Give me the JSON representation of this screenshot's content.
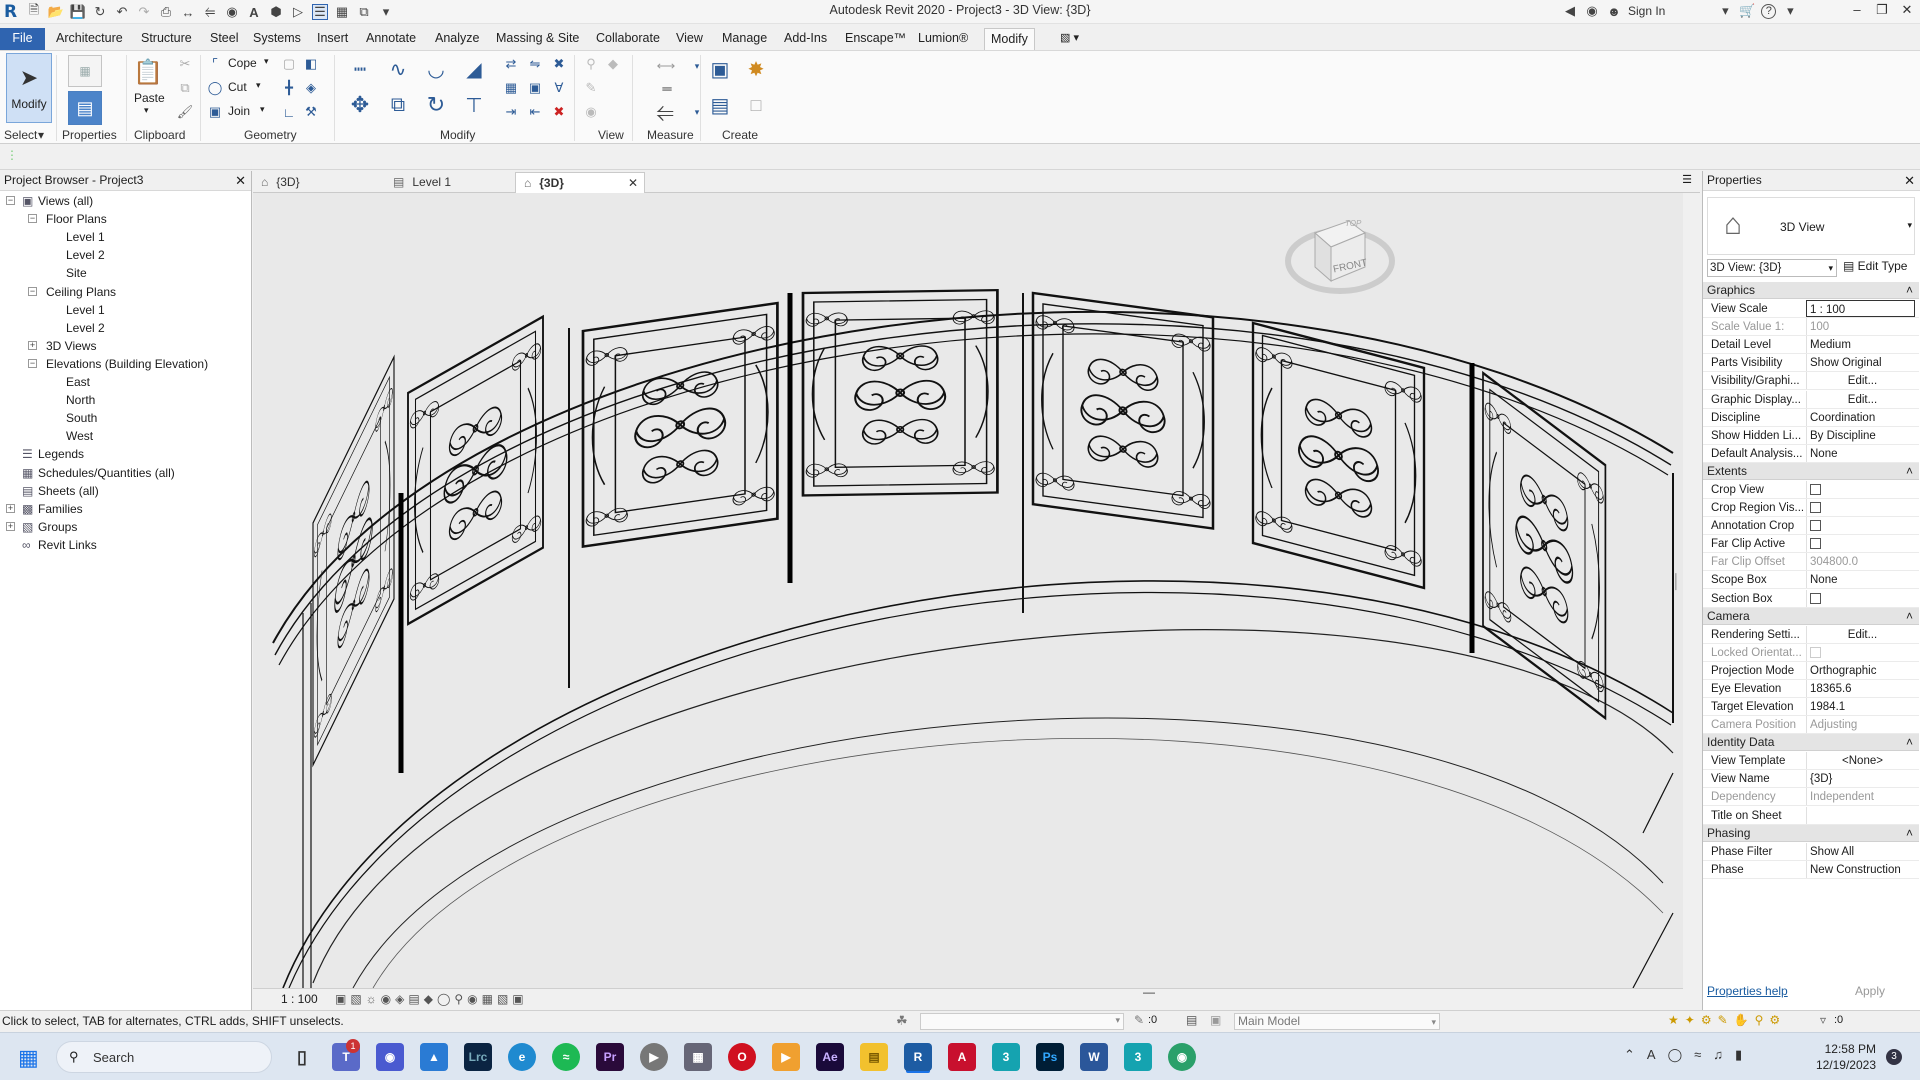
{
  "window": {
    "title": "Autodesk Revit 2020 - Project3 - 3D View: {3D}",
    "sign_in": "Sign In",
    "help": "?",
    "minimize": "–",
    "restore": "❐",
    "close": "✕"
  },
  "ribbon_tabs": [
    "File",
    "Architecture",
    "Structure",
    "Steel",
    "Systems",
    "Insert",
    "Annotate",
    "Analyze",
    "Massing & Site",
    "Collaborate",
    "View",
    "Manage",
    "Add-Ins",
    "Enscape™",
    "Lumion®",
    "Modify"
  ],
  "active_ribbon_tab": "Modify",
  "ribbon": {
    "modify_label": "Modify",
    "select_label": "Select",
    "properties_label": "Properties",
    "paste_label": "Paste",
    "clipboard_label": "Clipboard",
    "cope_label": "Cope",
    "cut_label": "Cut",
    "join_label": "Join",
    "geometry_label": "Geometry",
    "modify_panel_label": "Modify",
    "view_label": "View",
    "measure_label": "Measure",
    "create_label": "Create"
  },
  "project_browser": {
    "title": "Project Browser - Project3",
    "items": [
      {
        "label": "Views (all)",
        "level": 0,
        "toggle": "−",
        "icon": "views-icon"
      },
      {
        "label": "Floor Plans",
        "level": 1,
        "toggle": "−"
      },
      {
        "label": "Level 1",
        "level": 2
      },
      {
        "label": "Level 2",
        "level": 2
      },
      {
        "label": "Site",
        "level": 2
      },
      {
        "label": "Ceiling Plans",
        "level": 1,
        "toggle": "−"
      },
      {
        "label": "Level 1",
        "level": 2
      },
      {
        "label": "Level 2",
        "level": 2
      },
      {
        "label": "3D Views",
        "level": 1,
        "toggle": "+"
      },
      {
        "label": "Elevations (Building Elevation)",
        "level": 1,
        "toggle": "−"
      },
      {
        "label": "East",
        "level": 2
      },
      {
        "label": "North",
        "level": 2
      },
      {
        "label": "South",
        "level": 2
      },
      {
        "label": "West",
        "level": 2
      },
      {
        "label": "Legends",
        "level": 0,
        "icon": "legends-icon"
      },
      {
        "label": "Schedules/Quantities (all)",
        "level": 0,
        "icon": "schedules-icon"
      },
      {
        "label": "Sheets (all)",
        "level": 0,
        "icon": "sheets-icon"
      },
      {
        "label": "Families",
        "level": 0,
        "toggle": "+",
        "icon": "families-icon"
      },
      {
        "label": "Groups",
        "level": 0,
        "toggle": "+",
        "icon": "groups-icon"
      },
      {
        "label": "Revit Links",
        "level": 0,
        "icon": "links-icon"
      }
    ]
  },
  "view_tabs": [
    {
      "label": "{3D}",
      "active": false,
      "icon": "3d-view-icon"
    },
    {
      "label": "Level 1",
      "active": false,
      "icon": "floor-plan-icon"
    },
    {
      "label": "{3D}",
      "active": true,
      "icon": "3d-view-icon"
    }
  ],
  "view_control": {
    "scale": "1 : 100"
  },
  "viewcube": {
    "top": "TOP",
    "front": "FRONT"
  },
  "properties": {
    "title": "Properties",
    "type_name": "3D View",
    "selector": "3D View: {3D}",
    "edit_type": "Edit Type",
    "help_link": "Properties help",
    "apply": "Apply",
    "groups": [
      {
        "name": "Graphics",
        "rows": [
          {
            "label": "View Scale",
            "value": "1 : 100",
            "kind": "input"
          },
          {
            "label": "Scale Value    1:",
            "value": "100",
            "kind": "dim"
          },
          {
            "label": "Detail Level",
            "value": "Medium"
          },
          {
            "label": "Parts Visibility",
            "value": "Show Original"
          },
          {
            "label": "Visibility/Graphi...",
            "value": "Edit...",
            "kind": "btn"
          },
          {
            "label": "Graphic Display...",
            "value": "Edit...",
            "kind": "btn"
          },
          {
            "label": "Discipline",
            "value": "Coordination"
          },
          {
            "label": "Show Hidden Li...",
            "value": "By Discipline"
          },
          {
            "label": "Default Analysis...",
            "value": "None"
          }
        ]
      },
      {
        "name": "Extents",
        "rows": [
          {
            "label": "Crop View",
            "value": "",
            "kind": "check"
          },
          {
            "label": "Crop Region Vis...",
            "value": "",
            "kind": "check"
          },
          {
            "label": "Annotation Crop",
            "value": "",
            "kind": "check"
          },
          {
            "label": "Far Clip Active",
            "value": "",
            "kind": "check"
          },
          {
            "label": "Far Clip Offset",
            "value": "304800.0",
            "kind": "dim"
          },
          {
            "label": "Scope Box",
            "value": "None"
          },
          {
            "label": "Section Box",
            "value": "",
            "kind": "check"
          }
        ]
      },
      {
        "name": "Camera",
        "rows": [
          {
            "label": "Rendering Setti...",
            "value": "Edit...",
            "kind": "btn"
          },
          {
            "label": "Locked Orientat...",
            "value": "",
            "kind": "checkdim"
          },
          {
            "label": "Projection Mode",
            "value": "Orthographic"
          },
          {
            "label": "Eye Elevation",
            "value": "18365.6"
          },
          {
            "label": "Target Elevation",
            "value": "1984.1"
          },
          {
            "label": "Camera Position",
            "value": "Adjusting",
            "kind": "dim"
          }
        ]
      },
      {
        "name": "Identity Data",
        "rows": [
          {
            "label": "View Template",
            "value": "<None>",
            "kind": "btn"
          },
          {
            "label": "View Name",
            "value": "{3D}"
          },
          {
            "label": "Dependency",
            "value": "Independent",
            "kind": "dim"
          },
          {
            "label": "Title on Sheet",
            "value": ""
          }
        ]
      },
      {
        "name": "Phasing",
        "rows": [
          {
            "label": "Phase Filter",
            "value": "Show All"
          },
          {
            "label": "Phase",
            "value": "New Construction"
          }
        ]
      }
    ]
  },
  "status": {
    "hint": "Click to select, TAB for alternates, CTRL adds, SHIFT unselects.",
    "worksets_count": ":0",
    "model": "Main Model",
    "filter_count": ":0"
  },
  "taskbar": {
    "search": "Search",
    "time": "12:58 PM",
    "date": "12/19/2023",
    "notif_count": "3",
    "teams_badge": "1",
    "apps": [
      "taskview",
      "teams",
      "photos",
      "lrc",
      "edge",
      "spotify",
      "premiere",
      "media",
      "calc",
      "opera",
      "vlc",
      "aftereffects",
      "explorer",
      "revit",
      "acad",
      "3ds",
      "photoshop",
      "word",
      "3dsmax",
      "chrome"
    ]
  }
}
